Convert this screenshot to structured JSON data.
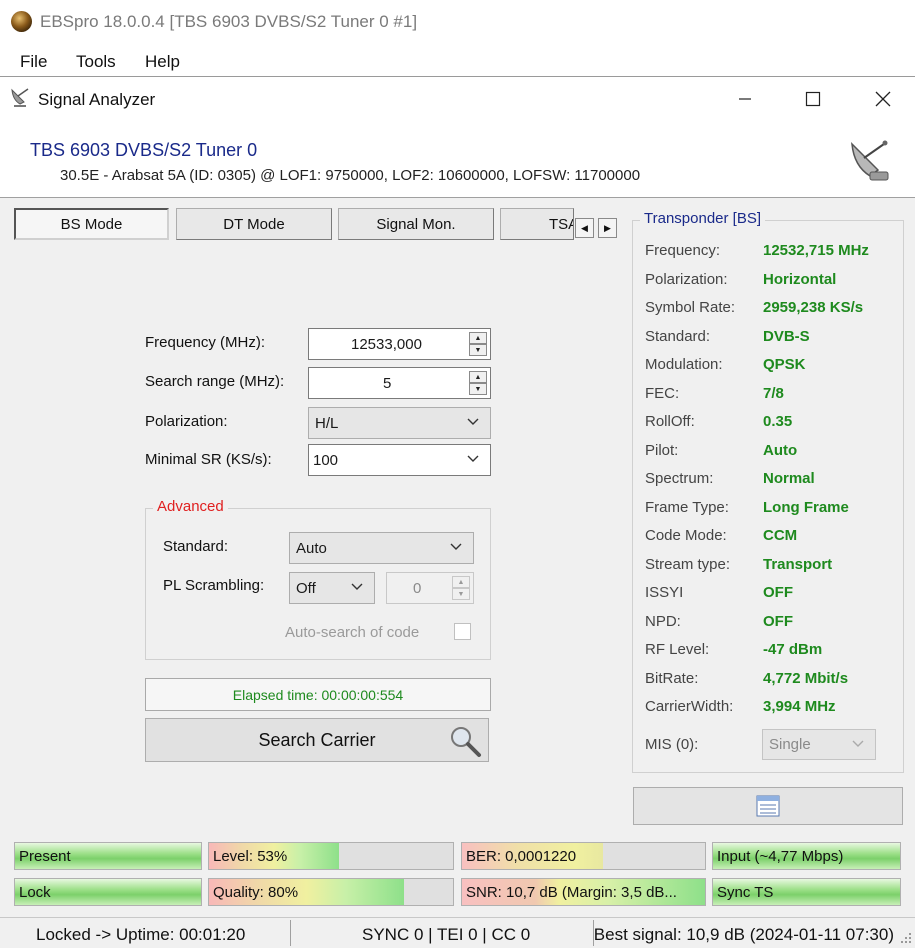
{
  "app": {
    "title": "EBSpro 18.0.0.4 [TBS 6903 DVBS/S2 Tuner 0 #1]"
  },
  "menu": [
    "File",
    "Tools",
    "Help"
  ],
  "dialog": {
    "title": "Signal Analyzer",
    "tuner_name": "TBS 6903 DVBS/S2 Tuner 0",
    "tuner_info": "30.5E - Arabsat 5A (ID: 0305) @ LOF1: 9750000, LOF2: 10600000, LOFSW: 11700000"
  },
  "tabs": [
    "BS Mode",
    "DT Mode",
    "Signal Mon.",
    "TSA"
  ],
  "form": {
    "frequency_label": "Frequency (MHz):",
    "frequency_value": "12533,000",
    "search_range_label": "Search range (MHz):",
    "search_range_value": "5",
    "polarization_label": "Polarization:",
    "polarization_value": "H/L",
    "min_sr_label": "Minimal SR (KS/s):",
    "min_sr_value": "100"
  },
  "advanced": {
    "title": "Advanced",
    "standard_label": "Standard:",
    "standard_value": "Auto",
    "pl_label": "PL Scrambling:",
    "pl_value": "Off",
    "pl_number": "0",
    "auto_search_label": "Auto-search of code"
  },
  "elapsed": "Elapsed time: 00:00:00:554",
  "search_button": "Search Carrier",
  "transponder": {
    "title": "Transponder [BS]",
    "rows": [
      {
        "label": "Frequency:",
        "value": "12532,715 MHz"
      },
      {
        "label": "Polarization:",
        "value": "Horizontal"
      },
      {
        "label": "Symbol Rate:",
        "value": "2959,238 KS/s"
      },
      {
        "label": "Standard:",
        "value": "DVB-S"
      },
      {
        "label": "Modulation:",
        "value": "QPSK"
      },
      {
        "label": "FEC:",
        "value": "7/8"
      },
      {
        "label": "RollOff:",
        "value": "0.35"
      },
      {
        "label": "Pilot:",
        "value": "Auto"
      },
      {
        "label": "Spectrum:",
        "value": "Normal"
      },
      {
        "label": "Frame Type:",
        "value": "Long Frame"
      },
      {
        "label": "Code Mode:",
        "value": "CCM"
      },
      {
        "label": "Stream type:",
        "value": "Transport"
      },
      {
        "label": "ISSYI",
        "value": "OFF"
      },
      {
        "label": "NPD:",
        "value": "OFF"
      },
      {
        "label": "RF Level:",
        "value": "-47 dBm"
      },
      {
        "label": "BitRate:",
        "value": "4,772 Mbit/s"
      },
      {
        "label": "CarrierWidth:",
        "value": "3,994 MHz"
      }
    ],
    "mis_label": "MIS (0):",
    "mis_value": "Single"
  },
  "indicators": {
    "present": "Present",
    "lock": "Lock",
    "level": "Level: 53%",
    "level_pct": 53,
    "quality": "Quality: 80%",
    "quality_pct": 80,
    "ber": "BER: 0,0001220",
    "snr": "SNR: 10,7 dB (Margin: 3,5 dB...",
    "input": "Input (~4,77 Mbps)",
    "sync": "Sync TS"
  },
  "statusbar": {
    "uptime": "Locked -> Uptime: 00:01:20",
    "sync": "SYNC 0 | TEI 0 | CC 0",
    "best": "Best signal: 10,9 dB (2024-01-11 07:30)"
  }
}
